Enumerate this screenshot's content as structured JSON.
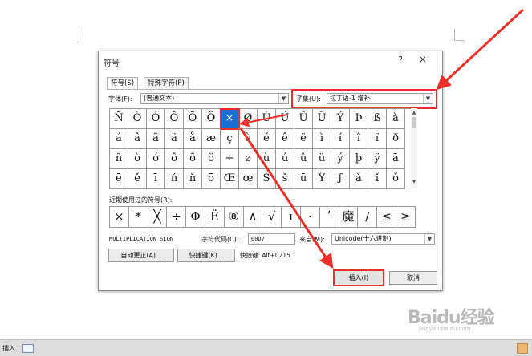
{
  "dialog": {
    "title": "符号",
    "help": "?",
    "close": "✕",
    "tabs": [
      "符号(S)",
      "特殊字符(P)"
    ],
    "font_label": "字体(F):",
    "font_value": "(普通文本)",
    "subset_label": "子集(U):",
    "subset_value": "拉丁语-1 增补",
    "grid": [
      [
        "Ñ",
        "Ò",
        "Ó",
        "Ô",
        "Õ",
        "Ö",
        "×",
        "Ø",
        "Ù",
        "Ú",
        "Û",
        "Ü",
        "Ý",
        "Þ",
        "ß",
        "à"
      ],
      [
        "á",
        "â",
        "ã",
        "ä",
        "å",
        "æ",
        "ç",
        "è",
        "é",
        "ê",
        "ë",
        "ì",
        "í",
        "î",
        "ï",
        "ð"
      ],
      [
        "ñ",
        "ò",
        "ó",
        "ô",
        "õ",
        "ö",
        "÷",
        "ø",
        "ù",
        "ú",
        "û",
        "ü",
        "ý",
        "þ",
        "ÿ",
        "ā"
      ],
      [
        "ē",
        "ě",
        "ī",
        "ń",
        "ň",
        "ō",
        "Œ",
        "œ",
        "Š",
        "š",
        "ū",
        "Ÿ",
        "ƒ",
        "ǎ",
        "ǐ",
        "ǒ"
      ]
    ],
    "selected_symbol": "×",
    "recent_label": "近期使用过的符号(R):",
    "recent": [
      "×",
      "*",
      "╳",
      "÷",
      "Φ",
      "Ë",
      "⑧",
      "∧",
      "√",
      "ı",
      "·",
      "ʹ",
      "魔",
      "/",
      "≤",
      "≥"
    ],
    "char_name": "MULTIPLICATION SIGN",
    "char_code_label": "字符代码(C):",
    "char_code": "00D7",
    "from_label": "来自(M):",
    "from_value": "Unicode(十六进制)",
    "autocorrect_button": "自动更正(A)...",
    "shortcut_button": "快捷键(K)...",
    "shortcut_text": "快捷键: Alt+0215",
    "insert_button": "插入(I)",
    "cancel_button": "取消"
  },
  "statusbar": {
    "text": "插入"
  },
  "watermark": {
    "brand": "Baidu经验",
    "url": "jingyan.baidu.com"
  },
  "colors": {
    "selection": "#1c6fd1",
    "annotation": "#e8312b"
  }
}
